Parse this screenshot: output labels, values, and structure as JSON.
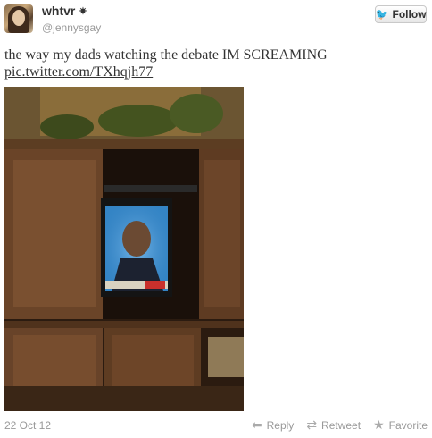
{
  "user": {
    "display_name": "whtvr",
    "screen_name": "@jennysgay",
    "verified_glyph": "✷"
  },
  "follow_button": {
    "label": "Follow",
    "icon": "twitter-bird-icon"
  },
  "tweet": {
    "text": "the way my dads watching the debate IM SCREAMING",
    "link": "pic.twitter.com/TXhqjh77"
  },
  "photo": {
    "description_icon": "photo"
  },
  "footer": {
    "date": "22 Oct 12",
    "actions": [
      {
        "label": "Reply",
        "icon": "reply-icon",
        "glyph": "⬅"
      },
      {
        "label": "Retweet",
        "icon": "retweet-icon",
        "glyph": "⇄"
      },
      {
        "label": "Favorite",
        "icon": "star-icon",
        "glyph": "★"
      }
    ]
  },
  "colors": {
    "link": "#333333",
    "muted": "#999999",
    "bird": "#2aa9e0"
  }
}
